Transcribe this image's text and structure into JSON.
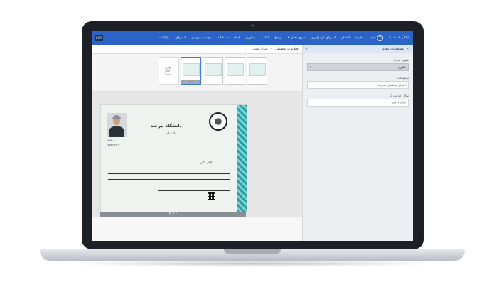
{
  "topbar": {
    "brand": "ECM",
    "items": [
      "بازگشت",
      "انصراف",
      "برچسب پیوندی",
      "ایجاد سند مشابه",
      "یادآوری",
      "امانت",
      "ارجاع",
      "شرح محتوا",
      "انصراف از نوآوری",
      "انتشار",
      "ذخیره"
    ],
    "new_label": "جدید",
    "user_label": "بایگانی اسناد"
  },
  "breadcrumb": {
    "root": "عنوان سند",
    "current": "اطلاعات تحصیلی",
    "more": "..."
  },
  "side_panel": {
    "title": "مشخصات محتوا",
    "doc_title_label": "عنوان مدرک",
    "doc_title_value": "دکتری",
    "description_label": "توضیحات",
    "description_value": "دکترای تخصصی مدیریت",
    "year_label": "سال اخذ مدرک",
    "year_value": "۱۳۸۲/۰۸/۱۷"
  },
  "document": {
    "university": "دانشگاه بیرجند",
    "subtitle": "دانشنامه",
    "name_line": "آقای دکتر",
    "serial": "۶۶۷۳۰۸",
    "id_no": "۲۲۸۸۶/۱۹۱۹"
  },
  "pager": "۴ از ۴",
  "colors": {
    "topbar": "#2b63c7",
    "side_panel": "#eceef2",
    "accent_border": "#2c9fa5"
  }
}
